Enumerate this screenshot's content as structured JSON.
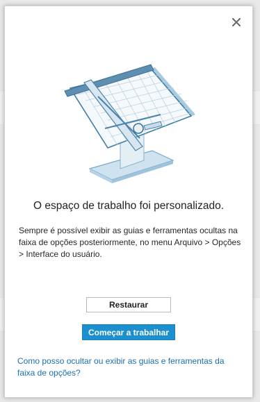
{
  "dialog": {
    "title": "O espaço de trabalho foi personalizado.",
    "description": "Sempre é possível exibir as guias e ferramentas ocultas na faixa de opções posteriormente, no menu Arquivo > Opções > Interface do usuário.",
    "restore_label": "Restaurar",
    "start_label": "Começar a trabalhar",
    "help_link": "Como posso ocultar ou exibir as guias e ferramentas da faixa de opções?"
  },
  "icons": {
    "close": "close-icon",
    "illustration": "drafting-table-illustration"
  },
  "colors": {
    "accent": "#1c8fcf",
    "link": "#1b6fb0",
    "illustration_blue": "#7bb4d6"
  }
}
